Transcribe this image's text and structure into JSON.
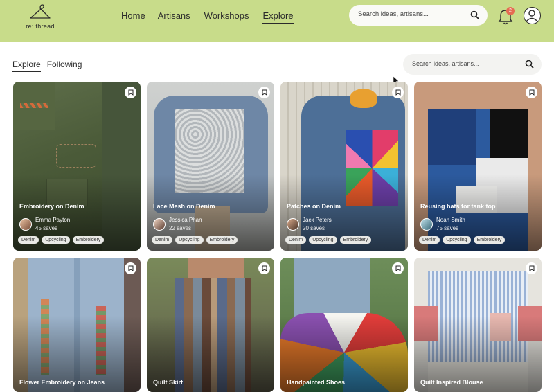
{
  "app": {
    "logo_text": "re: thread"
  },
  "nav": {
    "items": [
      "Home",
      "Artisans",
      "Workshops",
      "Explore"
    ],
    "active": "Explore"
  },
  "header_search": {
    "placeholder": "Search ideas, artisans..."
  },
  "notifications": {
    "count": "2"
  },
  "tabs": [
    "Explore",
    "Following"
  ],
  "sub_search": {
    "placeholder": "Search ideas, artisans..."
  },
  "colors": {
    "header_bg": "#c8dc8a",
    "badge": "#e56b52",
    "tag_bg": "#e9e9e6"
  },
  "cards": [
    {
      "title": "Embroidery on Denim",
      "author": "Emma Payton",
      "saves": "45 saves",
      "tags": [
        "Denim",
        "Upcycling",
        "Embroidery"
      ]
    },
    {
      "title": "Lace Mesh on Denim",
      "author": "Jessica Phan",
      "saves": "22 saves",
      "tags": [
        "Denim",
        "Upcycling",
        "Embroidery"
      ]
    },
    {
      "title": "Patches on Denim",
      "author": "Jack Peters",
      "saves": "20 saves",
      "tags": [
        "Denim",
        "Upcycling",
        "Embroidery"
      ]
    },
    {
      "title": "Reusing hats for tank top",
      "author": "Noah Smith",
      "saves": "75 saves",
      "tags": [
        "Denim",
        "Upcycling",
        "Embroidery"
      ]
    },
    {
      "title": "Flower Embroidery on Jeans"
    },
    {
      "title": "Quilt Skirt"
    },
    {
      "title": "Handpainted Shoes"
    },
    {
      "title": "Quilt Inspired Blouse"
    }
  ]
}
